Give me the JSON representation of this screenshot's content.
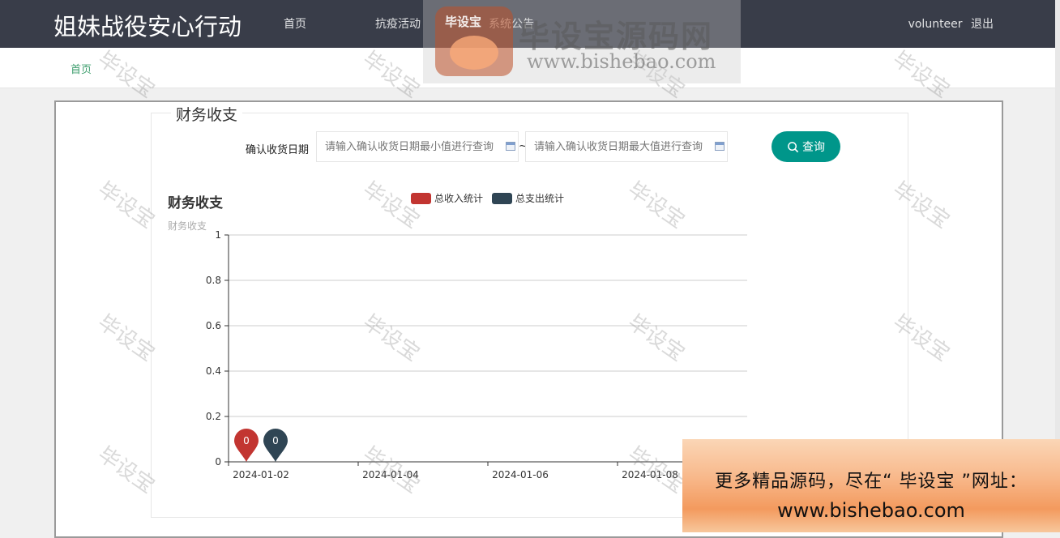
{
  "header": {
    "brand": "姐妹战役安心行动",
    "nav": [
      "首页",
      "抗疫活动",
      "系统公告"
    ],
    "user": "volunteer",
    "logout": "退出"
  },
  "breadcrumb": {
    "home": "首页"
  },
  "panel": {
    "title": "财务收支",
    "filter_label": "确认收货日期",
    "min_placeholder": "请输入确认收货日期最小值进行查询",
    "max_placeholder": "请输入确认收货日期最大值进行查询",
    "tilde": "~",
    "search_label": "查询",
    "search_icon": "search-icon"
  },
  "chart_data": {
    "type": "line",
    "title": "财务收支",
    "subtitle": "财务收支",
    "x": [
      "2024-01-02",
      "2024-01-04",
      "2024-01-06",
      "2024-01-08"
    ],
    "series": [
      {
        "name": "总收入统计",
        "color": "#c23531",
        "points": [
          {
            "x": "2024-01-02",
            "y": 0
          }
        ]
      },
      {
        "name": "总支出统计",
        "color": "#2f4554",
        "points": [
          {
            "x": "2024-01-02",
            "y": 0
          }
        ]
      }
    ],
    "yticks": [
      0,
      0.2,
      0.4,
      0.6,
      0.8,
      1
    ],
    "ylim": [
      0,
      1
    ],
    "grid": true,
    "legend_position": "top",
    "markers": "pin",
    "marker_labels": [
      "0",
      "0"
    ]
  },
  "watermark": {
    "text": "毕设宝",
    "logo_badge": "毕设宝",
    "logo_name": "毕设宝源码网",
    "logo_url": "www.bishebao.com",
    "banner_line1": "更多精品源码，尽在“ 毕设宝 ”网址：",
    "banner_line2": "www.bishebao.com"
  }
}
